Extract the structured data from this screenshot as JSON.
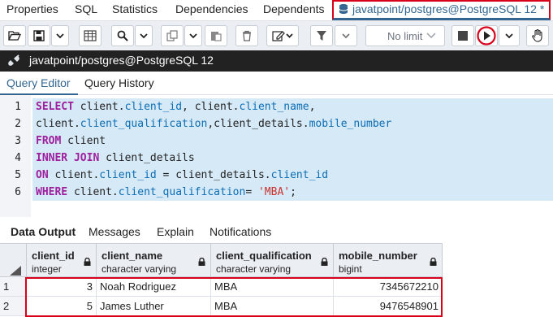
{
  "top_tabs": [
    {
      "label": "Properties"
    },
    {
      "label": "SQL"
    },
    {
      "label": "Statistics"
    },
    {
      "label": "Dependencies"
    },
    {
      "label": "Dependents"
    },
    {
      "label": "javatpoint/postgres@PostgreSQL 12 *",
      "icon": "database-icon",
      "active": true
    }
  ],
  "toolbar": {
    "limit_select": "No limit",
    "buttons": [
      "open-file-icon",
      "save-icon",
      "save-dropdown-icon",
      "grid-icon",
      "find-icon",
      "find-dropdown-icon",
      "copy-icon",
      "copy-dropdown-icon",
      "paste-icon",
      "delete-icon",
      "edit-icon",
      "edit-dropdown-icon",
      "filter-icon",
      "filter-dropdown-icon",
      "stop-icon",
      "execute-icon",
      "execute-dropdown-icon",
      "hand-icon"
    ]
  },
  "connection": {
    "title": "javatpoint/postgres@PostgreSQL 12",
    "icon": "connection-icon"
  },
  "editor_tabs": [
    {
      "label": "Query Editor",
      "active": true
    },
    {
      "label": "Query History"
    }
  ],
  "code": [
    {
      "ln": "1",
      "parts": [
        [
          "kw",
          "SELECT"
        ],
        [
          "t",
          " client."
        ],
        [
          "fld",
          "client_id"
        ],
        [
          "t",
          ", client."
        ],
        [
          "fld",
          "client_name"
        ],
        [
          "t",
          ","
        ]
      ]
    },
    {
      "ln": "2",
      "parts": [
        [
          "t",
          "client."
        ],
        [
          "fld",
          "client_qualification"
        ],
        [
          "t",
          ",client_details."
        ],
        [
          "fld",
          "mobile_number"
        ]
      ]
    },
    {
      "ln": "3",
      "parts": [
        [
          "kw",
          "FROM"
        ],
        [
          "t",
          " client"
        ]
      ]
    },
    {
      "ln": "4",
      "parts": [
        [
          "kw",
          "INNER JOIN"
        ],
        [
          "t",
          " client_details"
        ]
      ]
    },
    {
      "ln": "5",
      "parts": [
        [
          "kw",
          "ON"
        ],
        [
          "t",
          " client."
        ],
        [
          "fld",
          "client_id"
        ],
        [
          "t",
          " = client_details."
        ],
        [
          "fld",
          "client_id"
        ]
      ]
    },
    {
      "ln": "6",
      "parts": [
        [
          "kw",
          "WHERE"
        ],
        [
          "t",
          " client."
        ],
        [
          "fld",
          "client_qualification"
        ],
        [
          "t",
          "= "
        ],
        [
          "str",
          "'MBA'"
        ],
        [
          "t",
          ";"
        ]
      ]
    }
  ],
  "result_tabs": [
    {
      "label": "Data Output",
      "active": true
    },
    {
      "label": "Messages"
    },
    {
      "label": "Explain"
    },
    {
      "label": "Notifications"
    }
  ],
  "grid": {
    "columns": [
      {
        "name": "client_id",
        "type": "integer"
      },
      {
        "name": "client_name",
        "type": "character varying"
      },
      {
        "name": "client_qualification",
        "type": "character varying"
      },
      {
        "name": "mobile_number",
        "type": "bigint"
      }
    ],
    "rows": [
      {
        "n": "1",
        "cells": [
          "3",
          "Noah Rodriguez",
          "MBA",
          "7345672210"
        ]
      },
      {
        "n": "2",
        "cells": [
          "5",
          "James Luther",
          "MBA",
          "9476548901"
        ]
      }
    ]
  },
  "colors": {
    "accent": "#326690",
    "highlight": "#d9001b",
    "keyword": "#9d1f9d",
    "field": "#0b6db4",
    "string": "#c9312c",
    "selection": "#d6e9f7"
  }
}
